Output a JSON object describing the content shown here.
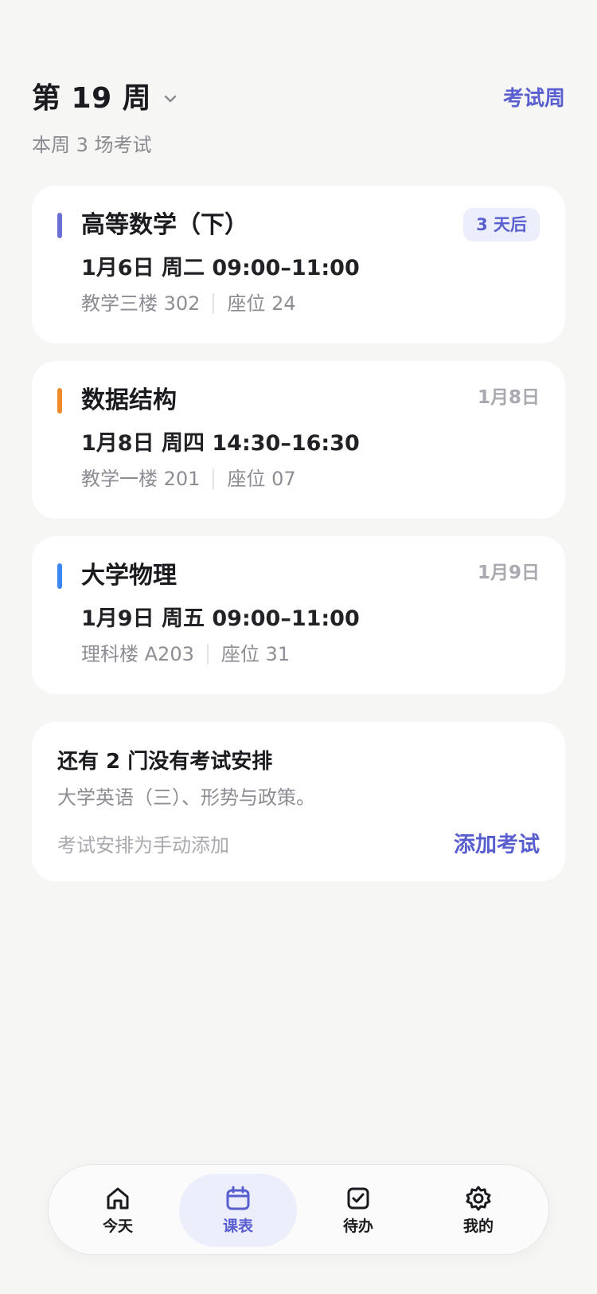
{
  "header": {
    "week_title": "第 19 周",
    "exam_week_label": "考试周",
    "subtitle": "本周 3 场考试"
  },
  "exams": [
    {
      "course": "高等数学（下）",
      "time": "1月6日 周二 09:00–11:00",
      "location": "教学三楼 302",
      "seat": "座位 24",
      "tag": "3 天后",
      "accent_color": "#6b6fd4"
    },
    {
      "course": "数据结构",
      "time": "1月8日 周四 14:30–16:30",
      "location": "教学一楼 201",
      "seat": "座位 07",
      "tag": "1月8日",
      "accent_color": "#ee8a2a"
    },
    {
      "course": "大学物理",
      "time": "1月9日 周五 09:00–11:00",
      "location": "理科楼 A203",
      "seat": "座位 31",
      "tag": "1月9日",
      "accent_color": "#3b86f2"
    }
  ],
  "unscheduled": {
    "title": "还有 2 门没有考试安排",
    "courses": "大学英语（三）、形势与政策。",
    "note": "考试安排为手动添加",
    "action_label": "添加考试"
  },
  "tabbar": {
    "tabs": [
      {
        "label": "今天",
        "icon": "home-icon",
        "active": false
      },
      {
        "label": "课表",
        "icon": "calendar-icon",
        "active": true
      },
      {
        "label": "待办",
        "icon": "check-square-icon",
        "active": false
      },
      {
        "label": "我的",
        "icon": "gear-icon",
        "active": false
      }
    ]
  },
  "colors": {
    "accent": "#5a5fcf",
    "background": "#f6f6f5",
    "card": "#ffffff"
  }
}
